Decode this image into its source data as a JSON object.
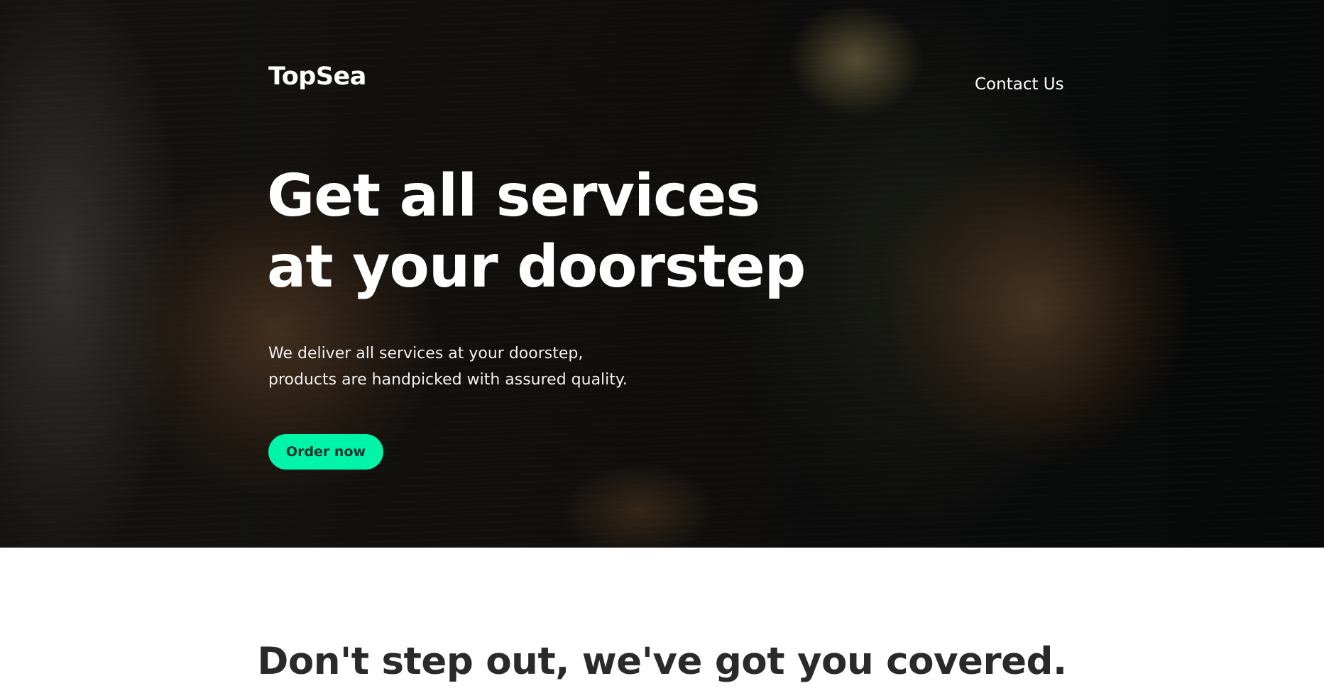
{
  "brand": {
    "logo_text": "TopSea"
  },
  "nav": {
    "contact_label": "Contact Us"
  },
  "hero": {
    "headline_line1": "Get all services",
    "headline_line2": "at your doorstep",
    "subtext_line1": "We deliver all services at your doorstep,",
    "subtext_line2": "products are handpicked with assured quality.",
    "cta_label": "Order now"
  },
  "section": {
    "heading": "Don't step out, we've got you covered."
  },
  "colors": {
    "accent": "#00f5a8",
    "heading_dark": "#2a2a2a",
    "hero_text": "#ffffff"
  }
}
